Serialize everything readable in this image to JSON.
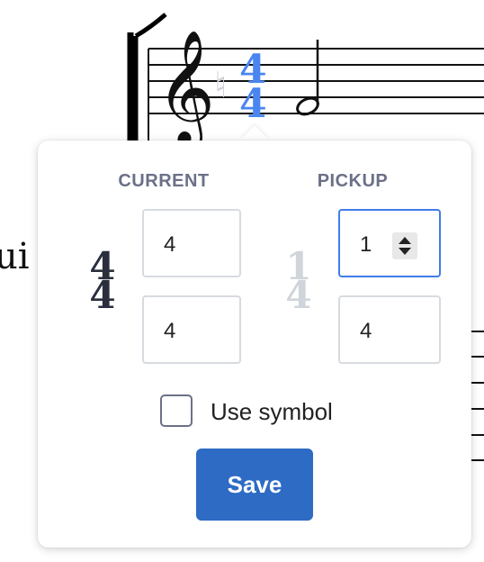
{
  "score": {
    "side_text": "ui",
    "current_time_signature": {
      "numerator": "4",
      "denominator": "4"
    }
  },
  "popover": {
    "current": {
      "title": "CURRENT",
      "preview": {
        "numerator": "4",
        "denominator": "4"
      },
      "numerator_value": "4",
      "denominator_value": "4"
    },
    "pickup": {
      "title": "PICKUP",
      "preview": {
        "numerator": "1",
        "denominator": "4"
      },
      "numerator_value": "1",
      "denominator_value": "4"
    },
    "use_symbol": {
      "label": "Use symbol",
      "checked": false
    },
    "save_label": "Save"
  },
  "colors": {
    "accent": "#2d6bc4",
    "selected_signature": "#4a86f0",
    "focus_border": "#3f7de8",
    "muted": "#6b7088"
  }
}
